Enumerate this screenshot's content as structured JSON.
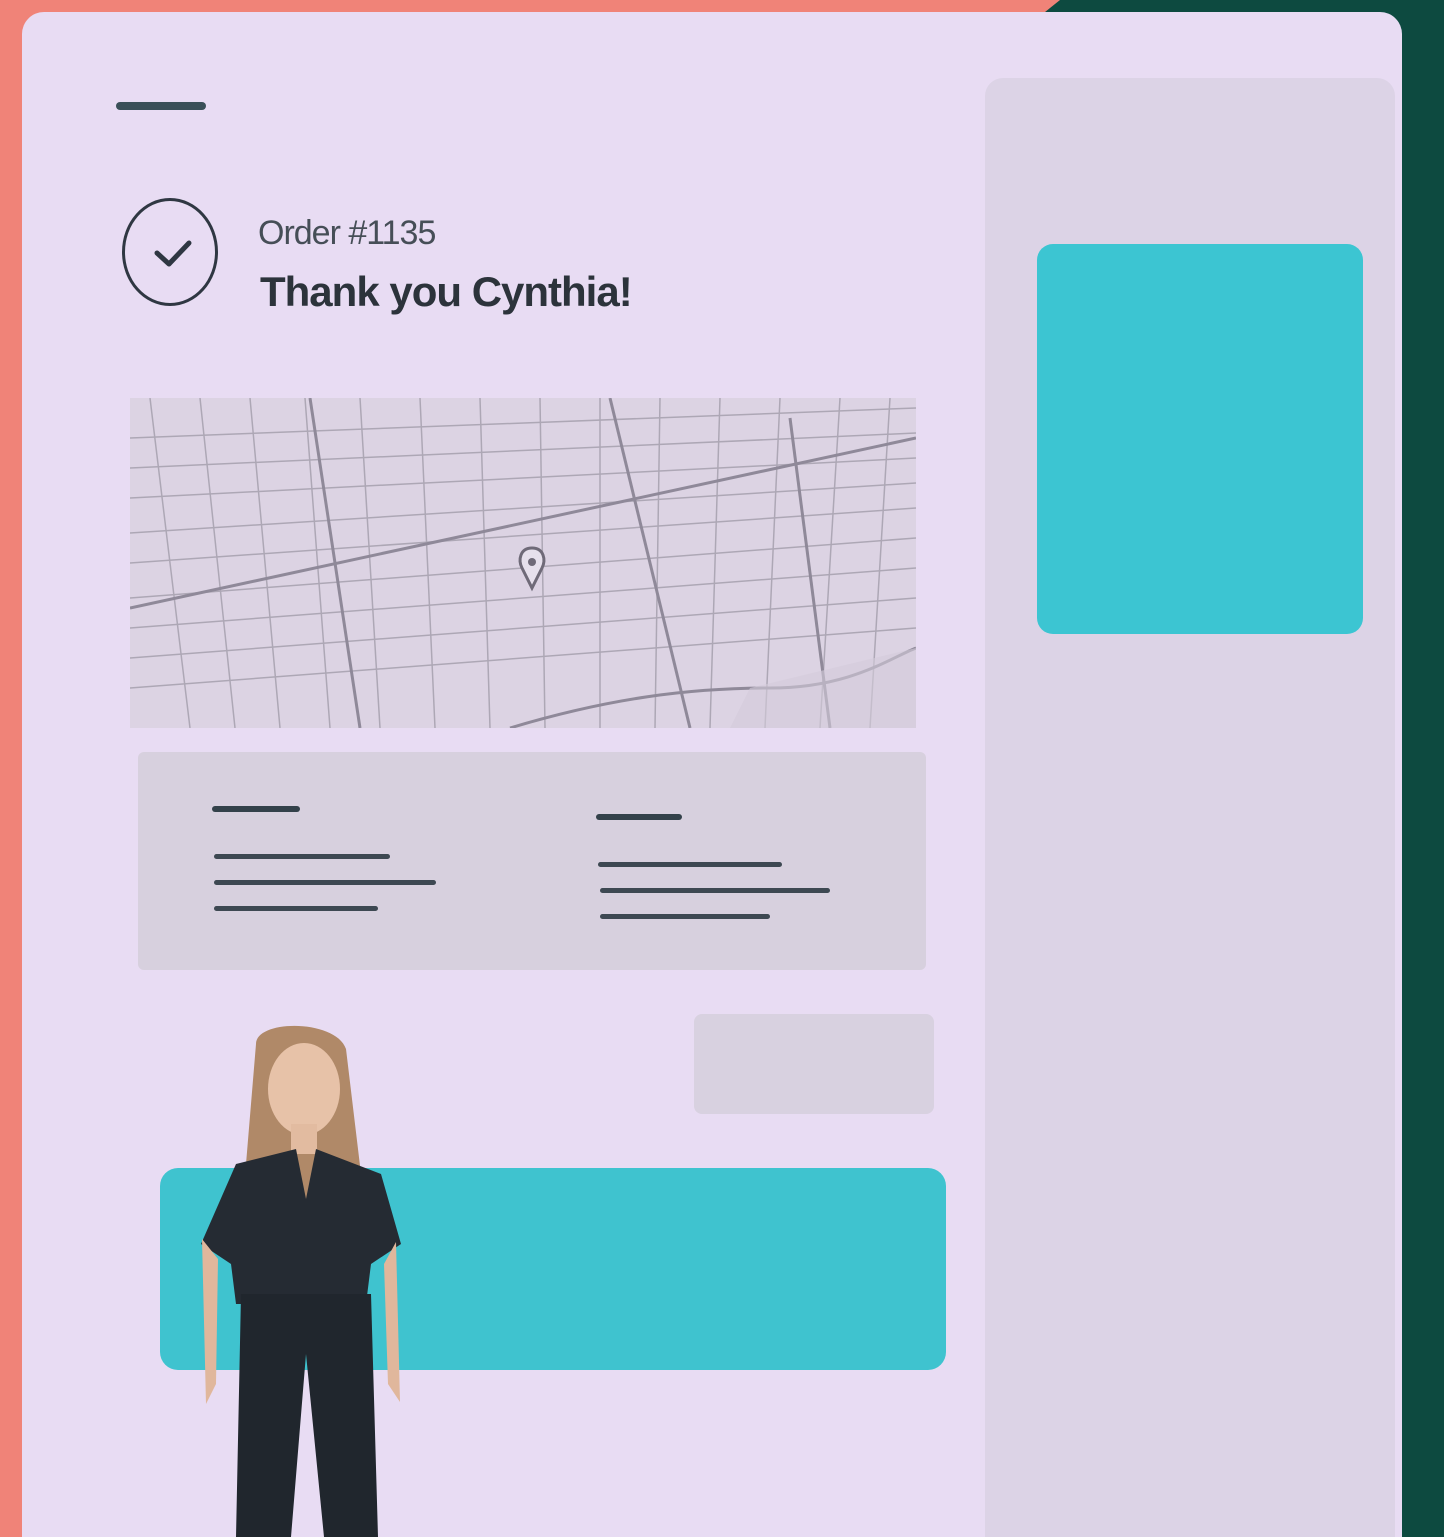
{
  "order": {
    "number_label": "Order #1135",
    "thanks_title": "Thank you Cynthia!"
  },
  "colors": {
    "accent": "#3fc3cf",
    "backdrop": "#f08378",
    "backdrop_dark": "#0d4a40",
    "screen": "#e8dcf3"
  },
  "icons": {
    "status": "checkmark-circle-icon",
    "map_marker": "map-pin-icon"
  }
}
